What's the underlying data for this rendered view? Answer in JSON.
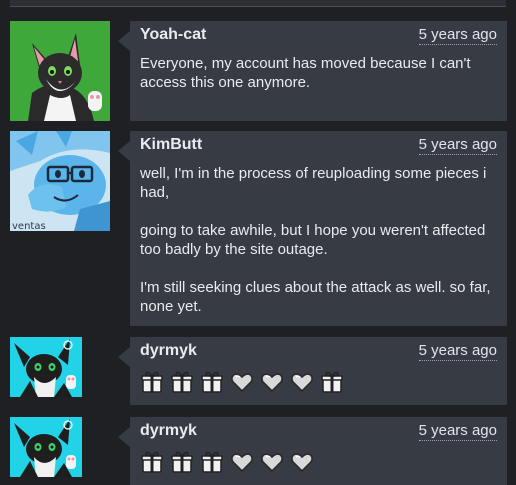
{
  "comments": [
    {
      "username": "Yoah-cat",
      "time": "5 years ago",
      "paragraphs": [
        "Everyone, my account has moved because I can't access this one anymore."
      ]
    },
    {
      "username": "KimButt",
      "time": "5 years ago",
      "avatar_signature": "ventas",
      "paragraphs": [
        "well, I'm in the process of reuploading some pieces i had,",
        "going to take awhile, but I hope you weren't affected too badly by the site outage.",
        "I'm still seeking clues about the attack as well. so far, none yet."
      ]
    },
    {
      "username": "dyrmyk",
      "time": "5 years ago",
      "icons": [
        "gift-icon",
        "gift-icon",
        "gift-icon",
        "heart-icon",
        "heart-icon",
        "heart-icon",
        "gift-icon"
      ]
    },
    {
      "username": "dyrmyk",
      "time": "5 years ago",
      "icons": [
        "gift-icon",
        "gift-icon",
        "gift-icon",
        "heart-icon",
        "heart-icon",
        "heart-icon"
      ]
    }
  ],
  "colors": {
    "background": "#1f2024",
    "bubble": "#363b44",
    "text": "#e9ebee"
  }
}
